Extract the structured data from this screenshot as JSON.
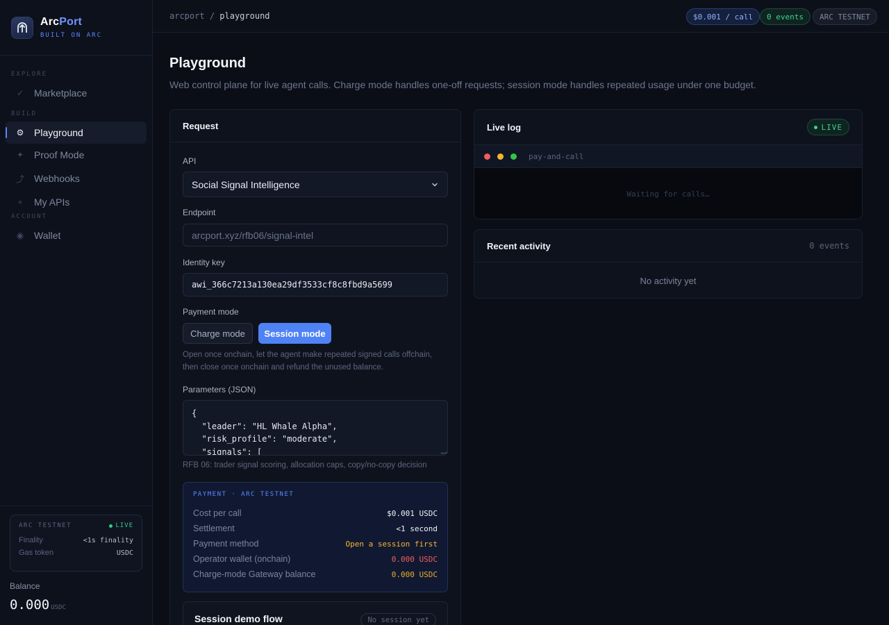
{
  "brand": {
    "name_part1": "Arc",
    "name_part2": "Port",
    "tagline": "BUILT ON ARC"
  },
  "nav": {
    "sections": {
      "explore": "EXPLORE",
      "build": "BUILD",
      "account": "ACCOUNT"
    },
    "items": {
      "marketplace": "Marketplace",
      "playground": "Playground",
      "proof_mode": "Proof Mode",
      "webhooks": "Webhooks",
      "my_apis": "My APIs",
      "wallet": "Wallet"
    },
    "active": "Playground"
  },
  "network": {
    "name": "ARC TESTNET",
    "status": "LIVE",
    "finality_label": "Finality",
    "finality_value": "<1s finality",
    "gas_label": "Gas token",
    "gas_value": "USDC"
  },
  "balance": {
    "label": "Balance",
    "value": "0.000",
    "unit": "USDC"
  },
  "topbar": {
    "crumb_root": "arcport",
    "crumb_sep": "/",
    "crumb_current": "playground",
    "price_pill": "$0.001 / call",
    "events_pill": "0 events",
    "network_pill": "ARC TESTNET"
  },
  "page": {
    "title": "Playground",
    "subtitle": "Web control plane for live agent calls. Charge mode handles one-off requests; session mode handles repeated usage under one budget."
  },
  "request": {
    "title": "Request",
    "api_label": "API",
    "api_value": "Social Signal Intelligence",
    "endpoint_label": "Endpoint",
    "endpoint_value": "arcport.xyz/rfb06/signal-intel",
    "identity_label": "Identity key",
    "identity_value": "awi_366c7213a130ea29df3533cf8c8fbd9a5699",
    "payment_mode_label": "Payment mode",
    "charge_button": "Charge mode",
    "session_button": "Session mode",
    "selected_mode": "Session mode",
    "mode_help": "Open once onchain, let the agent make repeated signed calls offchain, then close once onchain and refund the unused balance.",
    "params_label": "Parameters (JSON)",
    "params_value": "{\n  \"leader\": \"HL Whale Alpha\",\n  \"risk_profile\": \"moderate\",\n  \"signals\": [",
    "params_help": "RFB 06: trader signal scoring, allocation caps, copy/no-copy decision"
  },
  "payment": {
    "title": "PAYMENT · ARC TESTNET",
    "rows": [
      {
        "key": "Cost per call",
        "value": "$0.001 USDC"
      },
      {
        "key": "Settlement",
        "value": "<1 second"
      },
      {
        "key": "Payment method",
        "value": "Open a session first"
      },
      {
        "key": "Operator wallet (onchain)",
        "value": "0.000 USDC"
      },
      {
        "key": "Charge-mode Gateway balance",
        "value": "0.000 USDC"
      }
    ],
    "colors": {
      "warning": "#f2b52e",
      "danger": "#f05d5d",
      "gold": "#e6ad2a"
    }
  },
  "session_demo": {
    "title": "Session demo flow",
    "status": "No session yet"
  },
  "live_log": {
    "title": "Live log",
    "status": "LIVE",
    "terminal_name": "pay-and-call",
    "empty_text": "Waiting for calls…"
  },
  "activity": {
    "title": "Recent activity",
    "count": "0 events",
    "empty_text": "No activity yet"
  },
  "icons": {
    "logo": "arc-arrow-logo",
    "marketplace": "check-icon",
    "playground": "gear-icon",
    "proof_mode": "sparkle-icon",
    "webhooks": "webhook-icon",
    "my_apis": "plus-icon",
    "wallet": "wallet-dot-icon"
  },
  "accent_colors": {
    "primary": "#5b87ff",
    "success": "#3fd28f",
    "button": "#4f83f5"
  }
}
